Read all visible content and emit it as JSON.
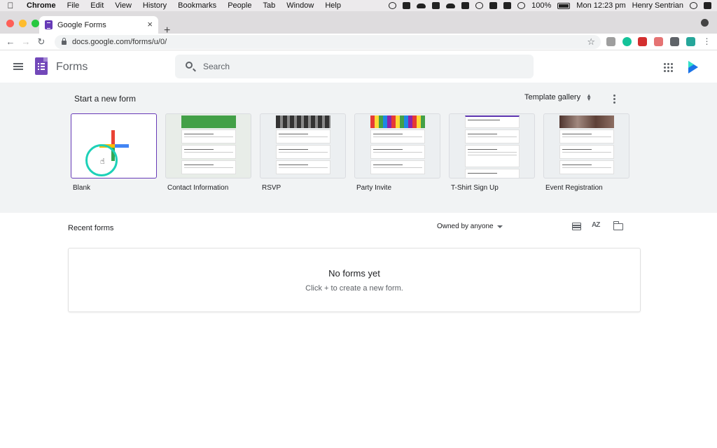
{
  "menubar": {
    "app": "Chrome",
    "items": [
      "File",
      "Edit",
      "View",
      "History",
      "Bookmarks",
      "People",
      "Tab",
      "Window",
      "Help"
    ],
    "battery": "100%",
    "clock": "Mon 12:23 pm",
    "user": "Henry Sentrian"
  },
  "browser": {
    "tab_title": "Google Forms",
    "tab_close": "×",
    "new_tab": "+",
    "url": "docs.google.com/forms/u/0/"
  },
  "header": {
    "title": "Forms",
    "search_placeholder": "Search"
  },
  "templates": {
    "heading": "Start a new form",
    "gallery_label": "Template gallery",
    "items": [
      {
        "label": "Blank"
      },
      {
        "label": "Contact Information",
        "color": "#43a047"
      },
      {
        "label": "RSVP",
        "color": "#555555"
      },
      {
        "label": "Party Invite",
        "color": "#e57373"
      },
      {
        "label": "T-Shirt Sign Up",
        "color": "#5e35b1"
      },
      {
        "label": "Event Registration",
        "color": "#6d4c41"
      }
    ]
  },
  "recent": {
    "heading": "Recent forms",
    "owner_filter": "Owned by anyone",
    "sort_label": "AZ",
    "empty_title": "No forms yet",
    "empty_hint": "Click + to create a new form."
  },
  "colors": {
    "accent": "#673ab7",
    "band": "#f1f3f4"
  }
}
